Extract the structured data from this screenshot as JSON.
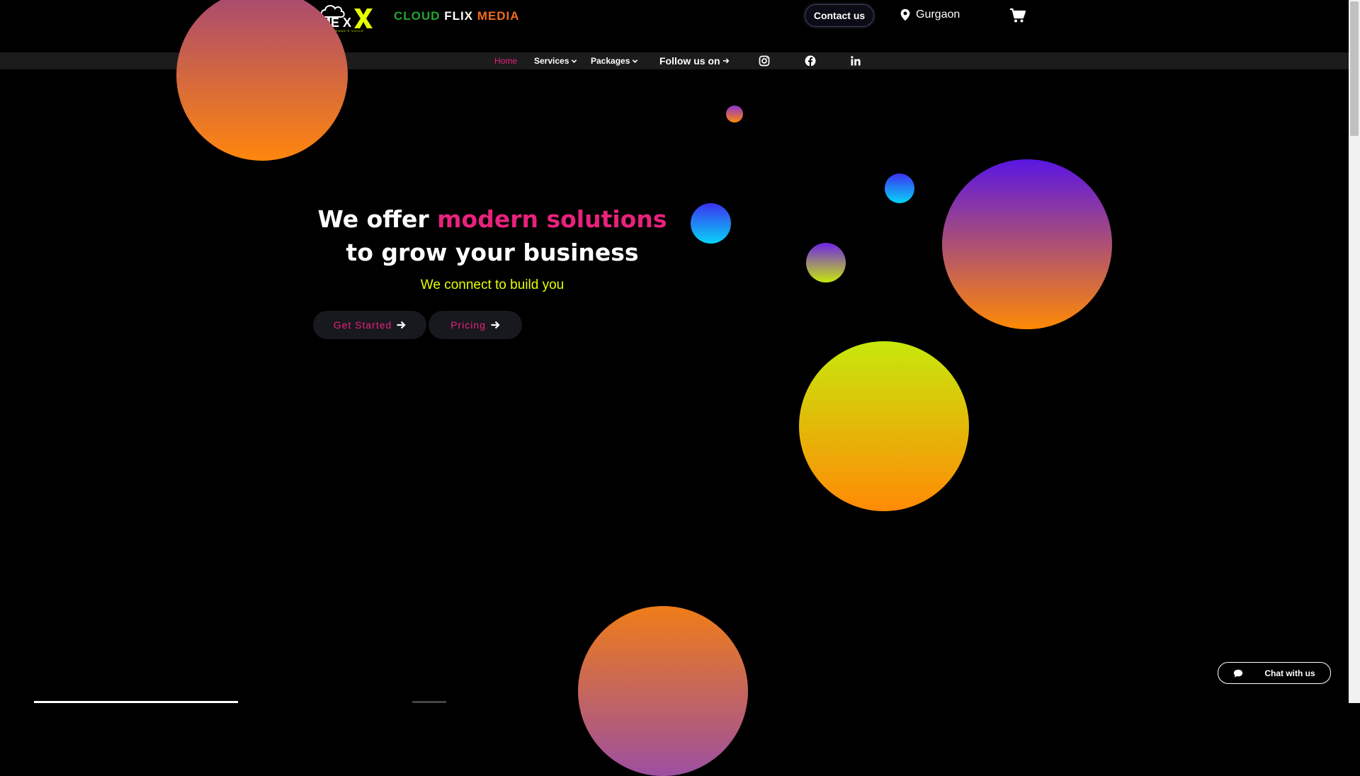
{
  "header": {
    "brand": {
      "word1": "CLOUD",
      "word2": "FLIX",
      "word3": "MEDIA"
    },
    "logo_text": "ME X",
    "logo_tagline": "YOUR BRAND'S VOICE",
    "contact_label": "Contact us",
    "location": "Gurgaon"
  },
  "nav": {
    "home": "Home",
    "services": "Services",
    "packages": "Packages",
    "follow": "Follow us on",
    "socials": [
      "instagram-icon",
      "facebook-icon",
      "linkedin-icon"
    ]
  },
  "hero": {
    "headline_part1": "We offer",
    "headline_accent": "modern solutions",
    "headline_part2": "to grow your business",
    "subheadline": "We connect to build you",
    "cta_primary": "Get Started",
    "cta_secondary": "Pricing"
  },
  "chat": {
    "label": "Chat with us"
  },
  "colors": {
    "accent": "#e8227c",
    "sub": "#e6ff00",
    "brand_green": "#22a52f",
    "brand_orange": "#f26b1d"
  }
}
